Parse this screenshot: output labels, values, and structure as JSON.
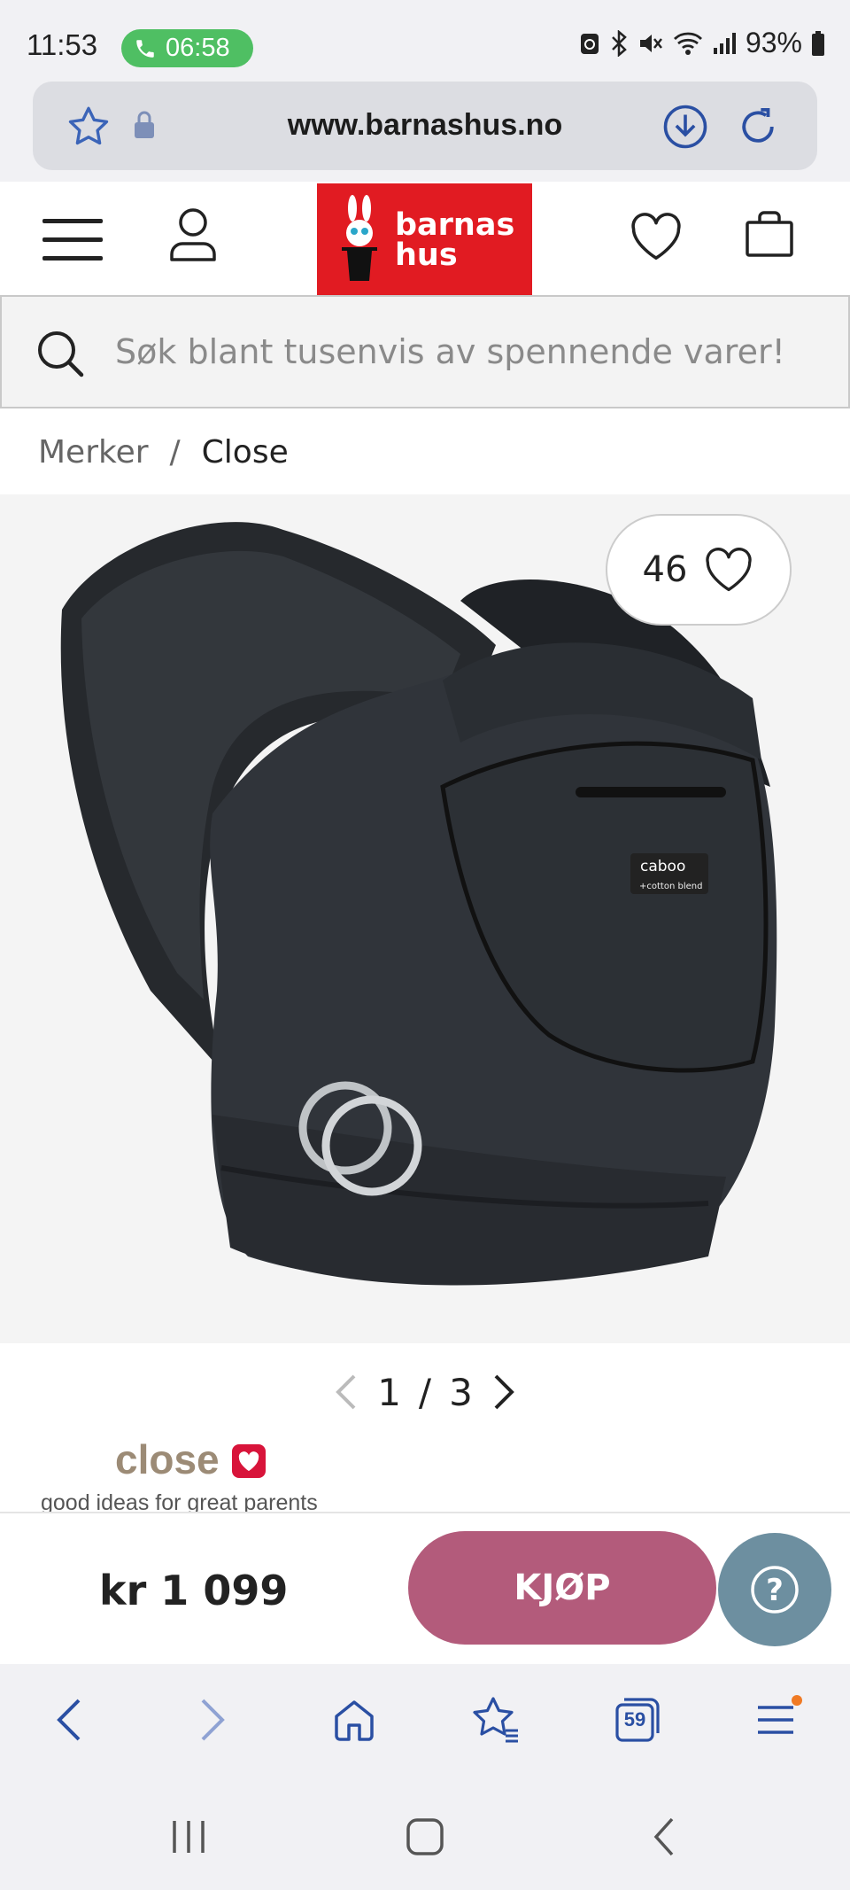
{
  "status_bar": {
    "time": "11:53",
    "call_timer": "06:58",
    "battery": "93%"
  },
  "browser": {
    "url": "www.barnashus.no",
    "tab_count": "59",
    "accent_color": "#2a4fa3"
  },
  "site": {
    "logo_line1": "barnas",
    "logo_line2": "hus",
    "brand_color": "#e11b22"
  },
  "search": {
    "placeholder": "Søk blant tusenvis av spennende varer!"
  },
  "breadcrumb": {
    "items": [
      "Merker",
      "Close"
    ],
    "separator": "/"
  },
  "product": {
    "favorites_count": "46",
    "logo_text": "caboo",
    "logo_subtext": "+cotton blend",
    "image_index": "1",
    "image_separator": "/",
    "image_total": "3"
  },
  "brand": {
    "name": "close",
    "tagline": "good ideas for great parents"
  },
  "purchase": {
    "price": "kr 1 099",
    "buy_label": "KJØP",
    "buy_color": "#b35b7b",
    "help_label": "?",
    "help_color": "#6d8fa0"
  }
}
